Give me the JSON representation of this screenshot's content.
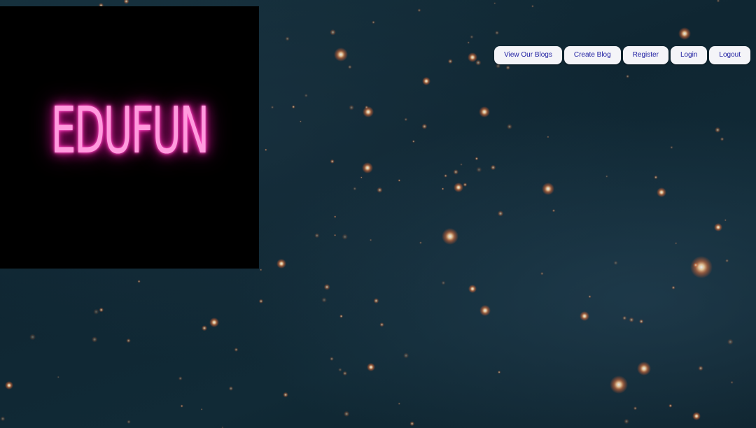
{
  "logo": {
    "text": "EDUFUN"
  },
  "nav": {
    "items": [
      {
        "label": "View Our Blogs"
      },
      {
        "label": "Create Blog"
      },
      {
        "label": "Register"
      },
      {
        "label": "Login"
      },
      {
        "label": "Logout"
      }
    ]
  },
  "colors": {
    "logo_glow": "#ff4fc4",
    "button_text": "#1a1aa0",
    "button_bg": "#f4f4f8",
    "logo_bg": "#000000"
  }
}
